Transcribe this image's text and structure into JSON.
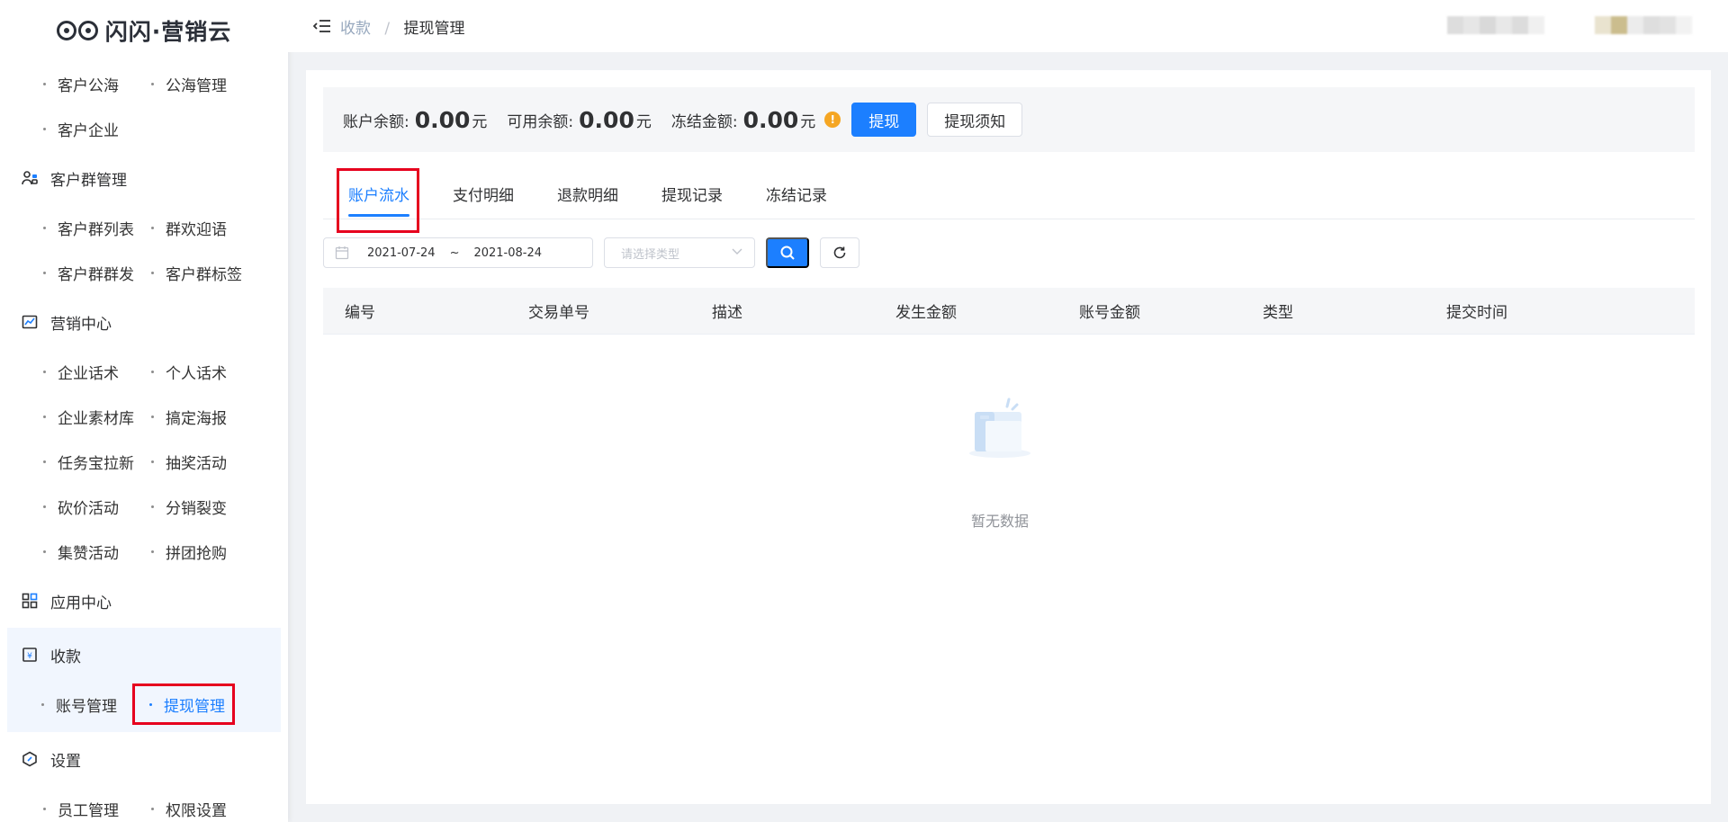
{
  "brand": {
    "name": "闪闪·营销云"
  },
  "sidebar": {
    "top_items": [
      "客户公海",
      "公海管理",
      "客户企业"
    ],
    "groups": [
      {
        "title": "客户群管理",
        "icon": "group-icon",
        "items": [
          "客户群列表",
          "群欢迎语",
          "客户群群发",
          "客户群标签"
        ]
      },
      {
        "title": "营销中心",
        "icon": "chart-icon",
        "items": [
          "企业话术",
          "个人话术",
          "企业素材库",
          "搞定海报",
          "任务宝拉新",
          "抽奖活动",
          "砍价活动",
          "分销裂变",
          "集赞活动",
          "拼团抢购"
        ]
      },
      {
        "title": "应用中心",
        "icon": "apps-icon",
        "items": []
      },
      {
        "title": "收款",
        "icon": "payment-icon",
        "items": [
          "账号管理",
          "提现管理"
        ],
        "active_item": "提现管理"
      },
      {
        "title": "设置",
        "icon": "settings-icon",
        "items": [
          "员工管理",
          "权限设置"
        ]
      }
    ]
  },
  "header": {
    "breadcrumb": {
      "parent": "收款",
      "separator": "/",
      "current": "提现管理"
    }
  },
  "balance": {
    "account_label": "账户余额:",
    "account_value": "0.00",
    "available_label": "可用余额:",
    "available_value": "0.00",
    "frozen_label": "冻结金额:",
    "frozen_value": "0.00",
    "unit": "元",
    "withdraw_button": "提现",
    "notice_button": "提现须知"
  },
  "tabs": [
    "账户流水",
    "支付明细",
    "退款明细",
    "提现记录",
    "冻结记录"
  ],
  "active_tab": "账户流水",
  "filters": {
    "start_date": "2021-07-24",
    "range_separator": "~",
    "end_date": "2021-08-24",
    "type_placeholder": "请选择类型"
  },
  "table": {
    "columns": [
      "编号",
      "交易单号",
      "描述",
      "发生金额",
      "账号金额",
      "类型",
      "提交时间"
    ],
    "rows": [],
    "empty_text": "暂无数据"
  },
  "colors": {
    "primary": "#1c7fff",
    "highlight_box": "#e6001e",
    "warning": "#f5a623"
  }
}
